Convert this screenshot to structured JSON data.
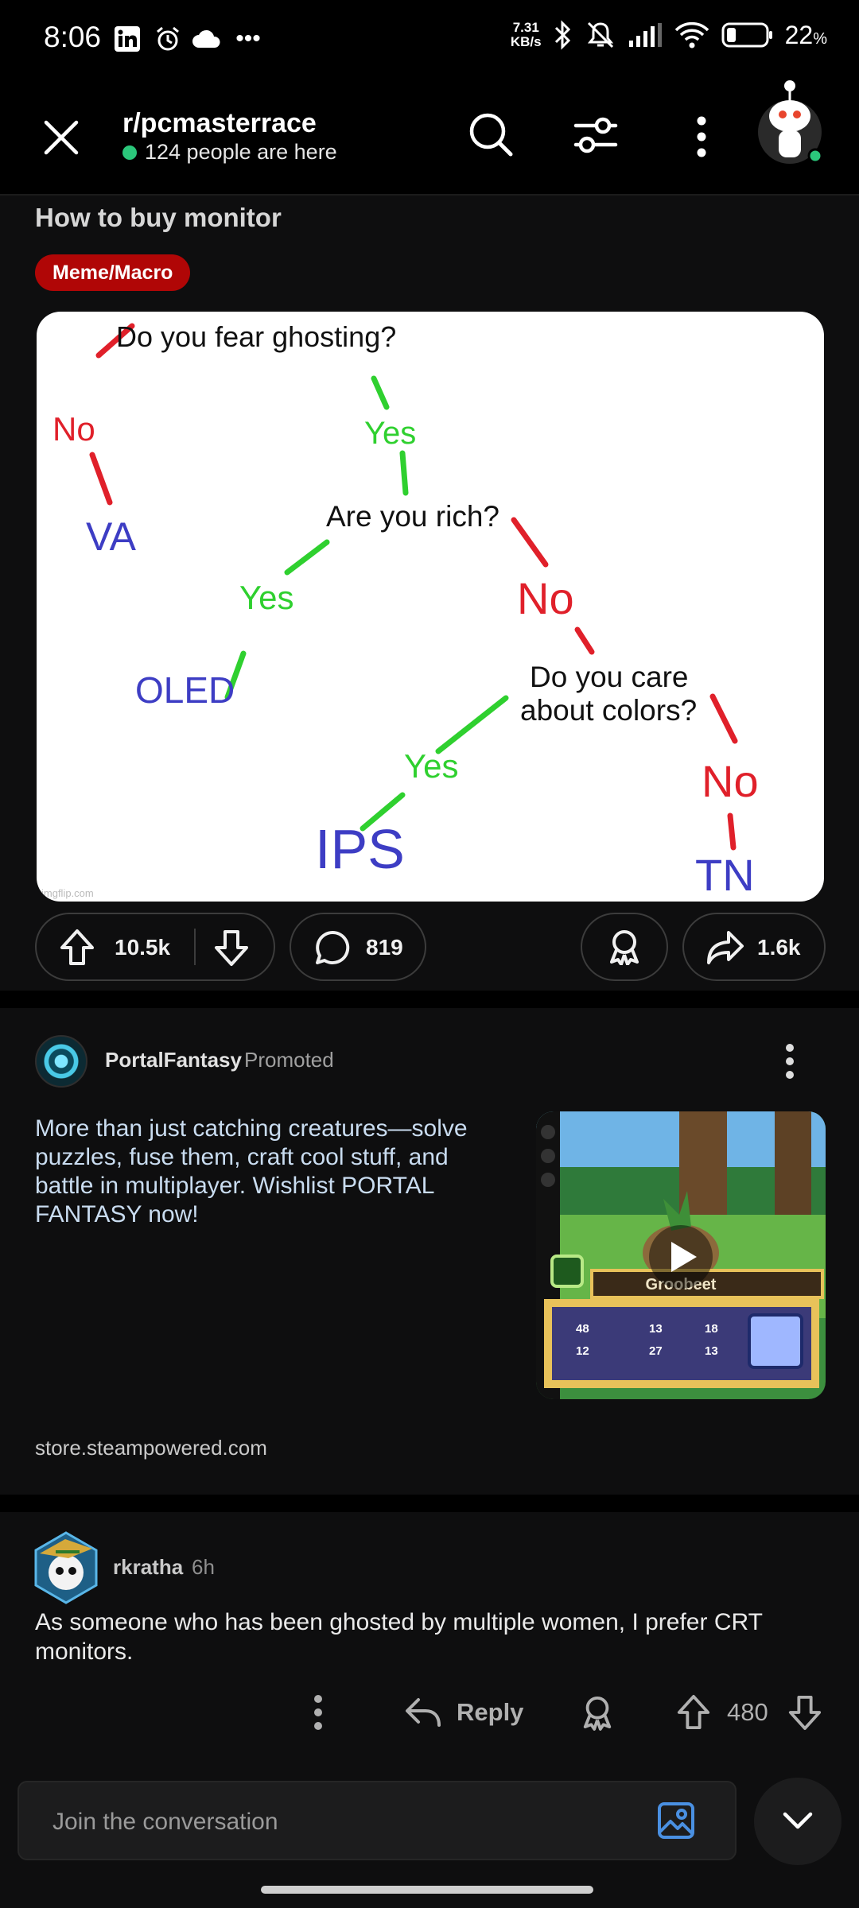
{
  "status_bar": {
    "time": "8:06",
    "speed_value": "7.31",
    "speed_unit": "KB/s",
    "battery": "22",
    "battery_unit": "%"
  },
  "header": {
    "subreddit": "r/pcmasterrace",
    "online": "124 people are here"
  },
  "post": {
    "title": "How to buy monitor",
    "flair": "Meme/Macro",
    "image_text": {
      "q1": "Do you fear ghosting?",
      "no1": "No",
      "yes1": "Yes",
      "va": "VA",
      "q2": "Are you rich?",
      "yes2": "Yes",
      "no2": "No",
      "oled": "OLED",
      "q3_line1": "Do you care",
      "q3_line2": "about colors?",
      "yes3": "Yes",
      "no3": "No",
      "ips": "IPS",
      "tn": "TN",
      "watermark": "imgflip.com"
    },
    "upvotes": "10.5k",
    "comments": "819",
    "shares": "1.6k"
  },
  "ad": {
    "advertiser": "PortalFantasy",
    "promoted_label": "Promoted",
    "text": "More than just catching creatures—solve puzzles, fuse them, craft cool stuff, and battle in multiplayer. Wishlist PORTAL FANTASY now!",
    "link": "store.steampowered.com",
    "thumb_creature": "Groobeet",
    "thumb_stats": [
      "48",
      "13",
      "18",
      "12",
      "27",
      "13"
    ]
  },
  "comment": {
    "user": "rkratha",
    "time": "6h",
    "body": "As someone who has been ghosted by multiple women, I prefer CRT monitors.",
    "reply_label": "Reply",
    "score": "480"
  },
  "composer": {
    "placeholder": "Join the conversation"
  },
  "colors": {
    "flair_bg": "#b00606",
    "online_dot": "#2bc77b",
    "tree_yes": "#2fd02f",
    "tree_no": "#e0202a",
    "tree_answer": "#3d3dc4"
  }
}
